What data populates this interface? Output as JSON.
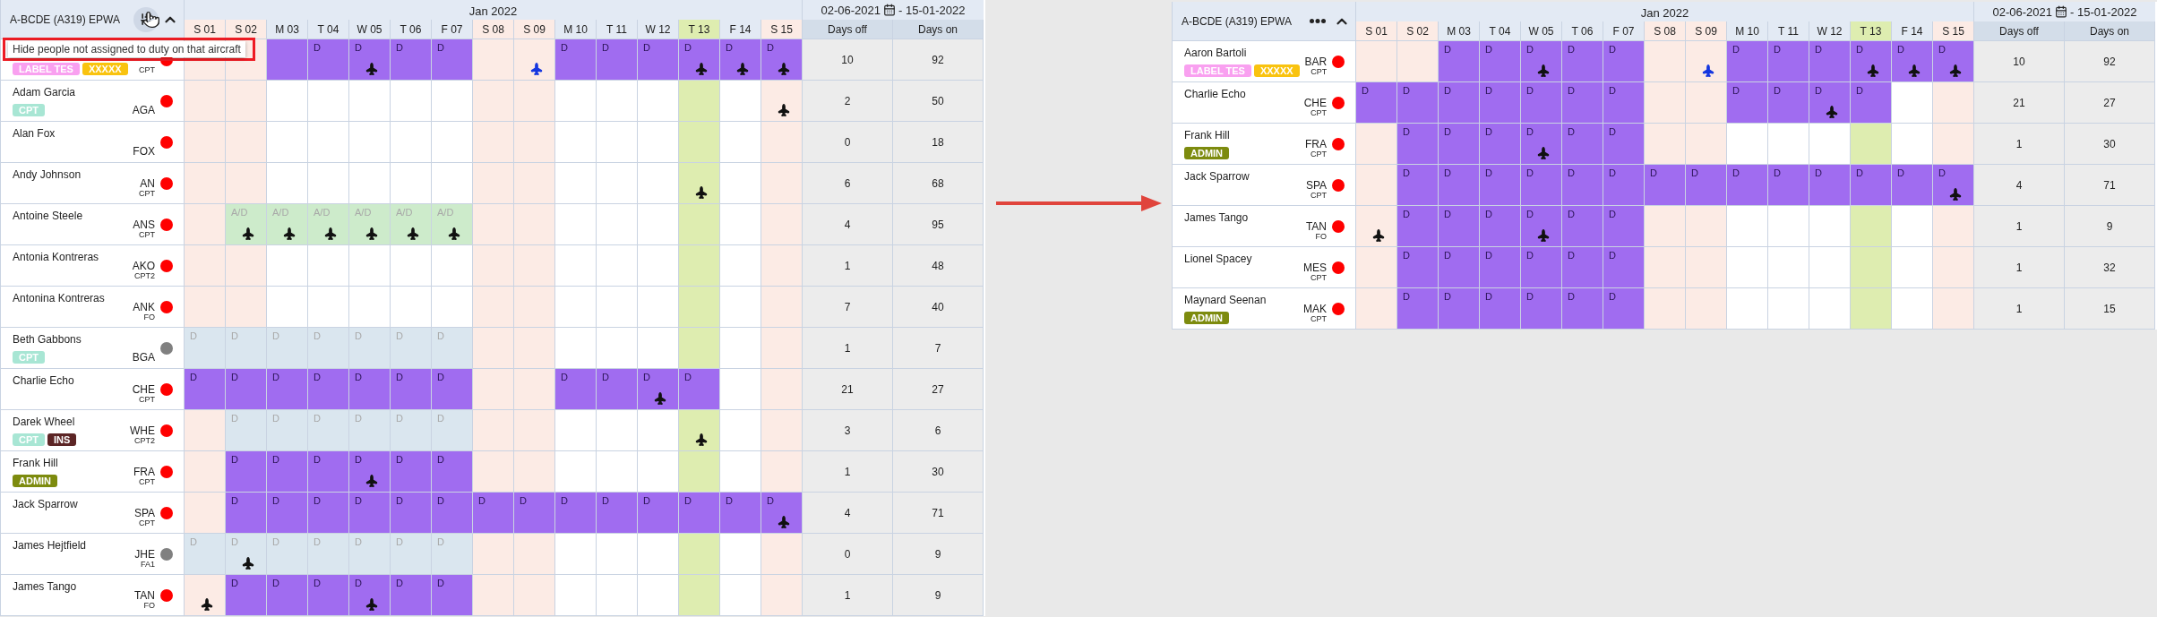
{
  "panels": [
    {
      "title": "A-BCDE (A319) EPWA",
      "menu": {
        "kind": "filter"
      },
      "tooltip": {
        "text": "Hide people not assigned to duty on that aircraft",
        "highlighted": true
      },
      "month": "Jan 2022",
      "range_start": "02-06-2021",
      "range_end": "- 15-01-2022",
      "stat_headers": [
        "Days off",
        "Days on"
      ],
      "columns": [
        {
          "label": "S 01",
          "kind": "weekend"
        },
        {
          "label": "S 02",
          "kind": "weekend"
        },
        {
          "label": "M 03",
          "kind": "weekday"
        },
        {
          "label": "T 04",
          "kind": "weekday"
        },
        {
          "label": "W 05",
          "kind": "weekday"
        },
        {
          "label": "T 06",
          "kind": "weekday"
        },
        {
          "label": "F 07",
          "kind": "weekday"
        },
        {
          "label": "S 08",
          "kind": "weekend"
        },
        {
          "label": "S 09",
          "kind": "weekend"
        },
        {
          "label": "M 10",
          "kind": "weekday"
        },
        {
          "label": "T 11",
          "kind": "weekday"
        },
        {
          "label": "W 12",
          "kind": "weekday"
        },
        {
          "label": "T 13",
          "kind": "today"
        },
        {
          "label": "F 14",
          "kind": "weekday"
        },
        {
          "label": "S 15",
          "kind": "weekend"
        }
      ],
      "rows": [
        {
          "role": "CPT",
          "color": "#ff0000",
          "badges": [
            {
              "text": "LABEL TES",
              "color": "#f9a0f0"
            },
            {
              "text": "XXXXX",
              "color": "#f9c30f"
            }
          ],
          "cells": [
            {
              "kind": "empty"
            },
            {
              "kind": "empty"
            },
            {
              "kind": "duty"
            },
            {
              "kind": "duty",
              "label": "D"
            },
            {
              "kind": "duty",
              "label": "D",
              "plane": {
                "kind": "regular"
              }
            },
            {
              "kind": "duty",
              "label": "D"
            },
            {
              "kind": "duty",
              "label": "D"
            },
            {
              "kind": "empty"
            },
            {
              "kind": "empty",
              "plane": {
                "kind": "highlighted"
              }
            },
            {
              "kind": "duty",
              "label": "D"
            },
            {
              "kind": "duty",
              "label": "D"
            },
            {
              "kind": "duty",
              "label": "D"
            },
            {
              "kind": "duty",
              "label": "D",
              "plane": {
                "kind": "regular"
              }
            },
            {
              "kind": "duty",
              "label": "D",
              "plane": {
                "kind": "regular"
              }
            },
            {
              "kind": "duty",
              "label": "D",
              "plane": {
                "kind": "regular"
              }
            }
          ],
          "days_off": "10",
          "days_on": "92"
        },
        {
          "name": "Adam Garcia",
          "code": "AGA",
          "color": "#ff0000",
          "badges": [
            {
              "text": "CPT",
              "color": "#a8e6d4"
            }
          ],
          "cells": [
            {
              "kind": "empty"
            },
            {
              "kind": "empty"
            },
            {
              "kind": "empty"
            },
            {
              "kind": "empty"
            },
            {
              "kind": "empty"
            },
            {
              "kind": "empty"
            },
            {
              "kind": "empty"
            },
            {
              "kind": "empty"
            },
            {
              "kind": "empty"
            },
            {
              "kind": "empty"
            },
            {
              "kind": "empty"
            },
            {
              "kind": "empty"
            },
            {
              "kind": "empty"
            },
            {
              "kind": "empty"
            },
            {
              "kind": "empty",
              "plane": {
                "kind": "regular"
              }
            }
          ],
          "days_off": "2",
          "days_on": "50"
        },
        {
          "name": "Alan Fox",
          "code": "FOX",
          "color": "#ff0000",
          "cells": [
            {
              "kind": "empty"
            },
            {
              "kind": "empty"
            },
            {
              "kind": "empty"
            },
            {
              "kind": "empty"
            },
            {
              "kind": "empty"
            },
            {
              "kind": "empty"
            },
            {
              "kind": "empty"
            },
            {
              "kind": "empty"
            },
            {
              "kind": "empty"
            },
            {
              "kind": "empty"
            },
            {
              "kind": "empty"
            },
            {
              "kind": "empty"
            },
            {
              "kind": "empty"
            },
            {
              "kind": "empty"
            },
            {
              "kind": "empty"
            }
          ],
          "days_off": "0",
          "days_on": "18"
        },
        {
          "name": "Andy Johnson",
          "code": "AN",
          "role": "CPT",
          "color": "#ff0000",
          "cells": [
            {
              "kind": "empty"
            },
            {
              "kind": "empty"
            },
            {
              "kind": "empty"
            },
            {
              "kind": "empty"
            },
            {
              "kind": "empty"
            },
            {
              "kind": "empty"
            },
            {
              "kind": "empty"
            },
            {
              "kind": "empty"
            },
            {
              "kind": "empty"
            },
            {
              "kind": "empty"
            },
            {
              "kind": "empty"
            },
            {
              "kind": "empty"
            },
            {
              "kind": "empty",
              "plane": {
                "kind": "regular"
              }
            },
            {
              "kind": "empty"
            },
            {
              "kind": "empty"
            }
          ],
          "days_off": "6",
          "days_on": "68"
        },
        {
          "name": "Antoine Steele",
          "code": "ANS",
          "role": "CPT",
          "color": "#ff0000",
          "cells": [
            {
              "kind": "empty"
            },
            {
              "kind": "standby",
              "label": "A/D",
              "plane": {
                "kind": "regular"
              }
            },
            {
              "kind": "standby",
              "label": "A/D",
              "plane": {
                "kind": "regular"
              }
            },
            {
              "kind": "standby",
              "label": "A/D",
              "plane": {
                "kind": "regular"
              }
            },
            {
              "kind": "standby",
              "label": "A/D",
              "plane": {
                "kind": "regular"
              }
            },
            {
              "kind": "standby",
              "label": "A/D",
              "plane": {
                "kind": "regular"
              }
            },
            {
              "kind": "standby",
              "label": "A/D",
              "plane": {
                "kind": "regular"
              }
            },
            {
              "kind": "empty"
            },
            {
              "kind": "empty"
            },
            {
              "kind": "empty"
            },
            {
              "kind": "empty"
            },
            {
              "kind": "empty"
            },
            {
              "kind": "empty"
            },
            {
              "kind": "empty"
            },
            {
              "kind": "empty"
            }
          ],
          "days_off": "4",
          "days_on": "95"
        },
        {
          "name": "Antonia Kontreras",
          "code": "AKO",
          "role": "CPT2",
          "color": "#ff0000",
          "cells": [
            {
              "kind": "empty"
            },
            {
              "kind": "empty"
            },
            {
              "kind": "empty"
            },
            {
              "kind": "empty"
            },
            {
              "kind": "empty"
            },
            {
              "kind": "empty"
            },
            {
              "kind": "empty"
            },
            {
              "kind": "empty"
            },
            {
              "kind": "empty"
            },
            {
              "kind": "empty"
            },
            {
              "kind": "empty"
            },
            {
              "kind": "empty"
            },
            {
              "kind": "empty"
            },
            {
              "kind": "empty"
            },
            {
              "kind": "empty"
            }
          ],
          "days_off": "1",
          "days_on": "48"
        },
        {
          "name": "Antonina Kontreras",
          "code": "ANK",
          "role": "FO",
          "color": "#ff0000",
          "cells": [
            {
              "kind": "empty"
            },
            {
              "kind": "empty"
            },
            {
              "kind": "empty"
            },
            {
              "kind": "empty"
            },
            {
              "kind": "empty"
            },
            {
              "kind": "empty"
            },
            {
              "kind": "empty"
            },
            {
              "kind": "empty"
            },
            {
              "kind": "empty"
            },
            {
              "kind": "empty"
            },
            {
              "kind": "empty"
            },
            {
              "kind": "empty"
            },
            {
              "kind": "empty"
            },
            {
              "kind": "empty"
            },
            {
              "kind": "empty"
            }
          ],
          "days_off": "7",
          "days_on": "40"
        },
        {
          "name": "Beth Gabbons",
          "code": "BGA",
          "color": "#808080",
          "badges": [
            {
              "text": "CPT",
              "color": "#a8e6d4"
            }
          ],
          "cells": [
            {
              "kind": "pending",
              "label": "D"
            },
            {
              "kind": "pending",
              "label": "D"
            },
            {
              "kind": "pending",
              "label": "D"
            },
            {
              "kind": "pending",
              "label": "D"
            },
            {
              "kind": "pending",
              "label": "D"
            },
            {
              "kind": "pending",
              "label": "D"
            },
            {
              "kind": "pending",
              "label": "D"
            },
            {
              "kind": "empty"
            },
            {
              "kind": "empty"
            },
            {
              "kind": "empty"
            },
            {
              "kind": "empty"
            },
            {
              "kind": "empty"
            },
            {
              "kind": "empty"
            },
            {
              "kind": "empty"
            },
            {
              "kind": "empty"
            }
          ],
          "days_off": "1",
          "days_on": "7"
        },
        {
          "name": "Charlie Echo",
          "code": "CHE",
          "role": "CPT",
          "color": "#ff0000",
          "cells": [
            {
              "kind": "duty",
              "label": "D"
            },
            {
              "kind": "duty",
              "label": "D"
            },
            {
              "kind": "duty",
              "label": "D"
            },
            {
              "kind": "duty",
              "label": "D"
            },
            {
              "kind": "duty",
              "label": "D"
            },
            {
              "kind": "duty",
              "label": "D"
            },
            {
              "kind": "duty",
              "label": "D"
            },
            {
              "kind": "empty"
            },
            {
              "kind": "empty"
            },
            {
              "kind": "duty",
              "label": "D"
            },
            {
              "kind": "duty",
              "label": "D"
            },
            {
              "kind": "duty",
              "label": "D",
              "plane": {
                "kind": "regular"
              }
            },
            {
              "kind": "duty",
              "label": "D"
            },
            {
              "kind": "empty"
            },
            {
              "kind": "empty"
            }
          ],
          "days_off": "21",
          "days_on": "27"
        },
        {
          "name": "Darek Wheel",
          "code": "WHE",
          "role": "CPT2",
          "color": "#ff0000",
          "badges": [
            {
              "text": "CPT",
              "color": "#a8e6d4"
            },
            {
              "text": "INS",
              "color": "#5c2525"
            }
          ],
          "cells": [
            {
              "kind": "empty"
            },
            {
              "kind": "pending",
              "label": "D"
            },
            {
              "kind": "pending",
              "label": "D"
            },
            {
              "kind": "pending",
              "label": "D"
            },
            {
              "kind": "pending",
              "label": "D"
            },
            {
              "kind": "pending",
              "label": "D"
            },
            {
              "kind": "pending",
              "label": "D"
            },
            {
              "kind": "empty"
            },
            {
              "kind": "empty"
            },
            {
              "kind": "empty"
            },
            {
              "kind": "empty"
            },
            {
              "kind": "empty"
            },
            {
              "kind": "empty",
              "plane": {
                "kind": "regular"
              }
            },
            {
              "kind": "empty"
            },
            {
              "kind": "empty"
            }
          ],
          "days_off": "3",
          "days_on": "6"
        },
        {
          "name": "Frank Hill",
          "code": "FRA",
          "role": "CPT",
          "color": "#ff0000",
          "badges": [
            {
              "text": "ADMIN",
              "color": "#7d8b0e"
            }
          ],
          "cells": [
            {
              "kind": "empty"
            },
            {
              "kind": "duty",
              "label": "D"
            },
            {
              "kind": "duty",
              "label": "D"
            },
            {
              "kind": "duty",
              "label": "D"
            },
            {
              "kind": "duty",
              "label": "D",
              "plane": {
                "kind": "regular"
              }
            },
            {
              "kind": "duty",
              "label": "D"
            },
            {
              "kind": "duty",
              "label": "D"
            },
            {
              "kind": "empty"
            },
            {
              "kind": "empty"
            },
            {
              "kind": "empty"
            },
            {
              "kind": "empty"
            },
            {
              "kind": "empty"
            },
            {
              "kind": "empty"
            },
            {
              "kind": "empty"
            },
            {
              "kind": "empty"
            }
          ],
          "days_off": "1",
          "days_on": "30"
        },
        {
          "name": "Jack Sparrow",
          "code": "SPA",
          "role": "CPT",
          "color": "#ff0000",
          "cells": [
            {
              "kind": "empty"
            },
            {
              "kind": "duty",
              "label": "D"
            },
            {
              "kind": "duty",
              "label": "D"
            },
            {
              "kind": "duty",
              "label": "D"
            },
            {
              "kind": "duty",
              "label": "D"
            },
            {
              "kind": "duty",
              "label": "D"
            },
            {
              "kind": "duty",
              "label": "D"
            },
            {
              "kind": "duty",
              "label": "D"
            },
            {
              "kind": "duty",
              "label": "D"
            },
            {
              "kind": "duty",
              "label": "D"
            },
            {
              "kind": "duty",
              "label": "D"
            },
            {
              "kind": "duty",
              "label": "D"
            },
            {
              "kind": "duty",
              "label": "D"
            },
            {
              "kind": "duty",
              "label": "D"
            },
            {
              "kind": "duty",
              "label": "D",
              "plane": {
                "kind": "regular"
              }
            }
          ],
          "days_off": "4",
          "days_on": "71"
        },
        {
          "name": "James Hejtfield",
          "code": "JHE",
          "role": "FA1",
          "color": "#808080",
          "cells": [
            {
              "kind": "pending",
              "label": "D"
            },
            {
              "kind": "pending",
              "label": "D",
              "plane": {
                "kind": "regular"
              }
            },
            {
              "kind": "pending",
              "label": "D"
            },
            {
              "kind": "pending",
              "label": "D"
            },
            {
              "kind": "pending",
              "label": "D"
            },
            {
              "kind": "pending",
              "label": "D"
            },
            {
              "kind": "pending",
              "label": "D"
            },
            {
              "kind": "empty"
            },
            {
              "kind": "empty"
            },
            {
              "kind": "empty"
            },
            {
              "kind": "empty"
            },
            {
              "kind": "empty"
            },
            {
              "kind": "empty"
            },
            {
              "kind": "empty"
            },
            {
              "kind": "empty"
            }
          ],
          "days_off": "0",
          "days_on": "9"
        },
        {
          "name": "James Tango",
          "code": "TAN",
          "role": "FO",
          "color": "#ff0000",
          "cells": [
            {
              "kind": "empty",
              "plane": {
                "kind": "regular"
              }
            },
            {
              "kind": "duty",
              "label": "D"
            },
            {
              "kind": "duty",
              "label": "D"
            },
            {
              "kind": "duty",
              "label": "D"
            },
            {
              "kind": "duty",
              "label": "D",
              "plane": {
                "kind": "regular"
              }
            },
            {
              "kind": "duty",
              "label": "D"
            },
            {
              "kind": "duty",
              "label": "D"
            },
            {
              "kind": "empty"
            },
            {
              "kind": "empty"
            },
            {
              "kind": "empty"
            },
            {
              "kind": "empty"
            },
            {
              "kind": "empty"
            },
            {
              "kind": "empty"
            },
            {
              "kind": "empty"
            },
            {
              "kind": "empty"
            }
          ],
          "days_off": "1",
          "days_on": "9"
        }
      ]
    },
    {
      "title": "A-BCDE (A319) EPWA",
      "menu": {
        "kind": "more"
      },
      "month": "Jan 2022",
      "range_start": "02-06-2021",
      "range_end": "- 15-01-2022",
      "stat_headers": [
        "Days off",
        "Days on"
      ],
      "columns": [
        {
          "label": "S 01",
          "kind": "weekend"
        },
        {
          "label": "S 02",
          "kind": "weekend"
        },
        {
          "label": "M 03",
          "kind": "weekday"
        },
        {
          "label": "T 04",
          "kind": "weekday"
        },
        {
          "label": "W 05",
          "kind": "weekday"
        },
        {
          "label": "T 06",
          "kind": "weekday"
        },
        {
          "label": "F 07",
          "kind": "weekday"
        },
        {
          "label": "S 08",
          "kind": "weekend"
        },
        {
          "label": "S 09",
          "kind": "weekend"
        },
        {
          "label": "M 10",
          "kind": "weekday"
        },
        {
          "label": "T 11",
          "kind": "weekday"
        },
        {
          "label": "W 12",
          "kind": "weekday"
        },
        {
          "label": "T 13",
          "kind": "today"
        },
        {
          "label": "F 14",
          "kind": "weekday"
        },
        {
          "label": "S 15",
          "kind": "weekend"
        }
      ],
      "rows": [
        {
          "name": "Aaron Bartoli",
          "code": "BAR",
          "role": "CPT",
          "color": "#ff0000",
          "badges": [
            {
              "text": "LABEL TES",
              "color": "#f9a0f0"
            },
            {
              "text": "XXXXX",
              "color": "#f9c30f"
            }
          ],
          "cells": [
            {
              "kind": "empty"
            },
            {
              "kind": "empty"
            },
            {
              "kind": "duty",
              "label": "D"
            },
            {
              "kind": "duty",
              "label": "D"
            },
            {
              "kind": "duty",
              "label": "D",
              "plane": {
                "kind": "regular"
              }
            },
            {
              "kind": "duty",
              "label": "D"
            },
            {
              "kind": "duty",
              "label": "D"
            },
            {
              "kind": "empty"
            },
            {
              "kind": "empty",
              "plane": {
                "kind": "highlighted"
              }
            },
            {
              "kind": "duty",
              "label": "D"
            },
            {
              "kind": "duty",
              "label": "D"
            },
            {
              "kind": "duty",
              "label": "D"
            },
            {
              "kind": "duty",
              "label": "D",
              "plane": {
                "kind": "regular"
              }
            },
            {
              "kind": "duty",
              "label": "D",
              "plane": {
                "kind": "regular"
              }
            },
            {
              "kind": "duty",
              "label": "D",
              "plane": {
                "kind": "regular"
              }
            }
          ],
          "days_off": "10",
          "days_on": "92"
        },
        {
          "name": "Charlie Echo",
          "code": "CHE",
          "role": "CPT",
          "color": "#ff0000",
          "cells": [
            {
              "kind": "duty",
              "label": "D"
            },
            {
              "kind": "duty",
              "label": "D"
            },
            {
              "kind": "duty",
              "label": "D"
            },
            {
              "kind": "duty",
              "label": "D"
            },
            {
              "kind": "duty",
              "label": "D"
            },
            {
              "kind": "duty",
              "label": "D"
            },
            {
              "kind": "duty",
              "label": "D"
            },
            {
              "kind": "empty"
            },
            {
              "kind": "empty"
            },
            {
              "kind": "duty",
              "label": "D"
            },
            {
              "kind": "duty",
              "label": "D"
            },
            {
              "kind": "duty",
              "label": "D",
              "plane": {
                "kind": "regular"
              }
            },
            {
              "kind": "duty",
              "label": "D"
            },
            {
              "kind": "empty"
            },
            {
              "kind": "empty"
            }
          ],
          "days_off": "21",
          "days_on": "27"
        },
        {
          "name": "Frank Hill",
          "code": "FRA",
          "role": "CPT",
          "color": "#ff0000",
          "badges": [
            {
              "text": "ADMIN",
              "color": "#7d8b0e"
            }
          ],
          "cells": [
            {
              "kind": "empty"
            },
            {
              "kind": "duty",
              "label": "D"
            },
            {
              "kind": "duty",
              "label": "D"
            },
            {
              "kind": "duty",
              "label": "D"
            },
            {
              "kind": "duty",
              "label": "D",
              "plane": {
                "kind": "regular"
              }
            },
            {
              "kind": "duty",
              "label": "D"
            },
            {
              "kind": "duty",
              "label": "D"
            },
            {
              "kind": "empty"
            },
            {
              "kind": "empty"
            },
            {
              "kind": "empty"
            },
            {
              "kind": "empty"
            },
            {
              "kind": "empty"
            },
            {
              "kind": "empty"
            },
            {
              "kind": "empty"
            },
            {
              "kind": "empty"
            }
          ],
          "days_off": "1",
          "days_on": "30"
        },
        {
          "name": "Jack Sparrow",
          "code": "SPA",
          "role": "CPT",
          "color": "#ff0000",
          "cells": [
            {
              "kind": "empty"
            },
            {
              "kind": "duty",
              "label": "D"
            },
            {
              "kind": "duty",
              "label": "D"
            },
            {
              "kind": "duty",
              "label": "D"
            },
            {
              "kind": "duty",
              "label": "D"
            },
            {
              "kind": "duty",
              "label": "D"
            },
            {
              "kind": "duty",
              "label": "D"
            },
            {
              "kind": "duty",
              "label": "D"
            },
            {
              "kind": "duty",
              "label": "D"
            },
            {
              "kind": "duty",
              "label": "D"
            },
            {
              "kind": "duty",
              "label": "D"
            },
            {
              "kind": "duty",
              "label": "D"
            },
            {
              "kind": "duty",
              "label": "D"
            },
            {
              "kind": "duty",
              "label": "D"
            },
            {
              "kind": "duty",
              "label": "D",
              "plane": {
                "kind": "regular"
              }
            }
          ],
          "days_off": "4",
          "days_on": "71"
        },
        {
          "name": "James Tango",
          "code": "TAN",
          "role": "FO",
          "color": "#ff0000",
          "cells": [
            {
              "kind": "empty",
              "plane": {
                "kind": "regular"
              }
            },
            {
              "kind": "duty",
              "label": "D"
            },
            {
              "kind": "duty",
              "label": "D"
            },
            {
              "kind": "duty",
              "label": "D"
            },
            {
              "kind": "duty",
              "label": "D",
              "plane": {
                "kind": "regular"
              }
            },
            {
              "kind": "duty",
              "label": "D"
            },
            {
              "kind": "duty",
              "label": "D"
            },
            {
              "kind": "empty"
            },
            {
              "kind": "empty"
            },
            {
              "kind": "empty"
            },
            {
              "kind": "empty"
            },
            {
              "kind": "empty"
            },
            {
              "kind": "empty"
            },
            {
              "kind": "empty"
            },
            {
              "kind": "empty"
            }
          ],
          "days_off": "1",
          "days_on": "9"
        },
        {
          "name": "Lionel Spacey",
          "code": "MES",
          "role": "CPT",
          "color": "#ff0000",
          "cells": [
            {
              "kind": "empty"
            },
            {
              "kind": "duty",
              "label": "D"
            },
            {
              "kind": "duty",
              "label": "D"
            },
            {
              "kind": "duty",
              "label": "D"
            },
            {
              "kind": "duty",
              "label": "D"
            },
            {
              "kind": "duty",
              "label": "D"
            },
            {
              "kind": "duty",
              "label": "D"
            },
            {
              "kind": "empty"
            },
            {
              "kind": "empty"
            },
            {
              "kind": "empty"
            },
            {
              "kind": "empty"
            },
            {
              "kind": "empty"
            },
            {
              "kind": "empty"
            },
            {
              "kind": "empty"
            },
            {
              "kind": "empty"
            }
          ],
          "days_off": "1",
          "days_on": "32"
        },
        {
          "name": "Maynard Seenan",
          "code": "MAK",
          "role": "CPT",
          "color": "#ff0000",
          "badges": [
            {
              "text": "ADMIN",
              "color": "#7d8b0e"
            }
          ],
          "cells": [
            {
              "kind": "empty"
            },
            {
              "kind": "duty",
              "label": "D"
            },
            {
              "kind": "duty",
              "label": "D"
            },
            {
              "kind": "duty",
              "label": "D"
            },
            {
              "kind": "duty",
              "label": "D"
            },
            {
              "kind": "duty",
              "label": "D"
            },
            {
              "kind": "duty",
              "label": "D"
            },
            {
              "kind": "empty"
            },
            {
              "kind": "empty"
            },
            {
              "kind": "empty"
            },
            {
              "kind": "empty"
            },
            {
              "kind": "empty"
            },
            {
              "kind": "empty"
            },
            {
              "kind": "empty"
            },
            {
              "kind": "empty"
            }
          ],
          "days_off": "1",
          "days_on": "15"
        }
      ]
    }
  ]
}
